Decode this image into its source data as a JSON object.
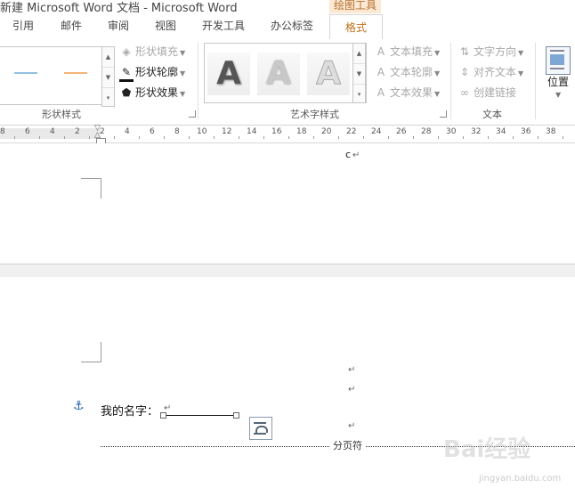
{
  "title": {
    "text": "新建 Microsoft Word 文档 - Microsoft Word",
    "context_tool": "绘图工具"
  },
  "tabs": [
    "引用",
    "邮件",
    "审阅",
    "视图",
    "开发工具",
    "办公标签",
    "格式"
  ],
  "ribbon": {
    "shape_styles": {
      "label": "形状样式",
      "fill": "形状填充",
      "outline": "形状轮廓",
      "effect": "形状效果",
      "line_colors": [
        "#8fc1e0",
        "#f3b57a"
      ]
    },
    "wordart": {
      "label": "艺术字样式",
      "glyph": "A",
      "text_fill": "文本填充",
      "text_outline": "文本轮廓",
      "text_effect": "文本效果"
    },
    "text": {
      "label": "文本",
      "direction": "文字方向",
      "align": "对齐文本",
      "link": "创建链接"
    },
    "position": {
      "label": "位置"
    }
  },
  "ruler": {
    "labels": [
      "8",
      "6",
      "4",
      "2",
      "2",
      "4",
      "6",
      "8",
      "10",
      "12",
      "14",
      "16",
      "18",
      "20",
      "22",
      "24",
      "26",
      "28",
      "30",
      "32",
      "34",
      "36",
      "38"
    ]
  },
  "doc": {
    "top_char": "c",
    "para_mark": "↵",
    "name_label": "我的名字：",
    "page_break": "分页符"
  },
  "watermark": {
    "text": "Bai经验",
    "sub": "jingyan.baidu.com"
  },
  "colors": {
    "accent": "#c0701c",
    "context_bg": "#fce9d5"
  }
}
